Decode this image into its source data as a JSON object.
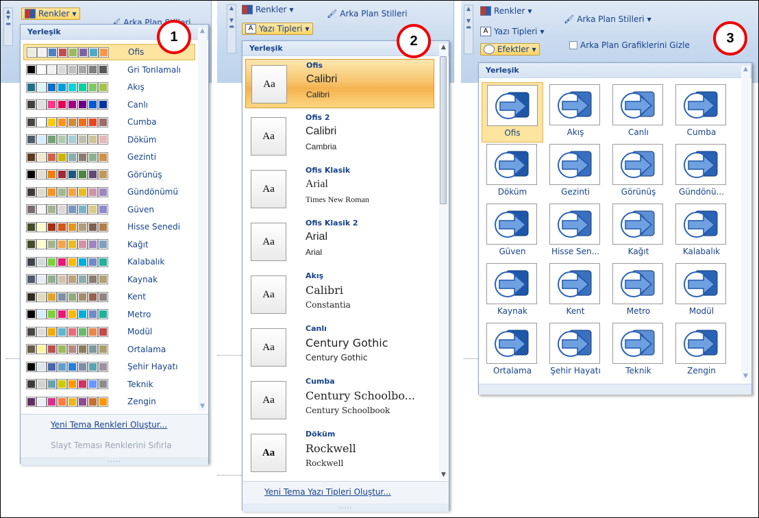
{
  "panel1": {
    "ribbon_button": "Renkler",
    "ribbon_neighbor": "Arka Plan Stilleri",
    "header": "Yerleşik",
    "badge": "1",
    "items": [
      {
        "label": "Ofis",
        "colors": [
          "#eeece1",
          "#f2f2f2",
          "#4f81bd",
          "#c0504d",
          "#9bbb59",
          "#8064a2",
          "#4bacc6",
          "#f79646"
        ]
      },
      {
        "label": "Gri Tonlamalı",
        "colors": [
          "#000000",
          "#ffffff",
          "#f2f2f2",
          "#d9d9d9",
          "#bfbfbf",
          "#a6a6a6",
          "#7f7f7f",
          "#595959"
        ]
      },
      {
        "label": "Akış",
        "colors": [
          "#1f6f8b",
          "#dbf5f9",
          "#0f6fc6",
          "#009dd9",
          "#0bd0d9",
          "#10cf9b",
          "#7cca62",
          "#a5c249"
        ]
      },
      {
        "label": "Canlı",
        "colors": [
          "#404040",
          "#dfdfdf",
          "#ff388c",
          "#e40059",
          "#9c007f",
          "#68007f",
          "#005bd3",
          "#00349e"
        ]
      },
      {
        "label": "Cumba",
        "colors": [
          "#444444",
          "#ffffff",
          "#ffca08",
          "#f8931d",
          "#ce8d3e",
          "#ec7016",
          "#e64823",
          "#9c6a6a"
        ]
      },
      {
        "label": "Döküm",
        "colors": [
          "#4e5b6f",
          "#d6ecff",
          "#72a376",
          "#b0ccb0",
          "#a8cdd7",
          "#c0beaf",
          "#cec597",
          "#e8b7b7"
        ]
      },
      {
        "label": "Gezinti",
        "colors": [
          "#5e3a1c",
          "#f4e7cc",
          "#d16349",
          "#ccb400",
          "#8cadae",
          "#8c7b70",
          "#8fb08c",
          "#d19049"
        ]
      },
      {
        "label": "Görünüş",
        "colors": [
          "#000000",
          "#e3ded1",
          "#f07f09",
          "#9f2936",
          "#1b587c",
          "#4e8542",
          "#604878",
          "#c19859"
        ]
      },
      {
        "label": "Gündönümü",
        "colors": [
          "#3a3a3a",
          "#dfdccb",
          "#f8931d",
          "#a5b592",
          "#f3a447",
          "#e7bc29",
          "#d092a7",
          "#9c85c0"
        ]
      },
      {
        "label": "Güven",
        "colors": [
          "#786c71",
          "#f8f5f6",
          "#a5b592",
          "#ded7d7",
          "#7a98bd",
          "#7ab4c8",
          "#dccb86",
          "#8f89d1"
        ]
      },
      {
        "label": "Hisse Senedi",
        "colors": [
          "#444d26",
          "#fefac9",
          "#a5300f",
          "#d55816",
          "#e19825",
          "#b19c7d",
          "#7f5f52",
          "#b27d49"
        ]
      },
      {
        "label": "Kağıt",
        "colors": [
          "#444d26",
          "#fefac9",
          "#a5b592",
          "#f3a447",
          "#e7bc29",
          "#d092a7",
          "#9c85c0",
          "#809ec2"
        ]
      },
      {
        "label": "Kalabalık",
        "colors": [
          "#3c434d",
          "#d4d9dd",
          "#7fd13b",
          "#ea157a",
          "#feb80a",
          "#00addc",
          "#738ac8",
          "#1ab39f"
        ]
      },
      {
        "label": "Kaynak",
        "colors": [
          "#4e5b6f",
          "#e6ecf5",
          "#8fb08c",
          "#d1c2b0",
          "#bea07a",
          "#8cadae",
          "#8c7b70",
          "#b0a179"
        ]
      },
      {
        "label": "Kent",
        "colors": [
          "#2f2b20",
          "#dfdcb7",
          "#e0a52c",
          "#7f8fa9",
          "#95a97f",
          "#a28e6a",
          "#956251",
          "#918485"
        ]
      },
      {
        "label": "Metro",
        "colors": [
          "#000000",
          "#d6ecff",
          "#7fd13b",
          "#ea157a",
          "#feb80a",
          "#00addc",
          "#738ac8",
          "#1ab39f"
        ]
      },
      {
        "label": "Modül",
        "colors": [
          "#464646",
          "#dedede",
          "#f0ad00",
          "#60b5cc",
          "#e66c7d",
          "#6bb76d",
          "#e88651",
          "#c64847"
        ]
      },
      {
        "label": "Ortalama",
        "colors": [
          "#695d46",
          "#fff39d",
          "#c0504d",
          "#9bbb59",
          "#b58b80",
          "#8b7e5e",
          "#7e9a9e",
          "#ac9f6e"
        ]
      },
      {
        "label": "Şehir Hayatı",
        "colors": [
          "#000000",
          "#dde4ed",
          "#4a66ac",
          "#629dd1",
          "#297fd5",
          "#7f8fa9",
          "#5aa2ae",
          "#9d90a0"
        ]
      },
      {
        "label": "Teknik",
        "colors": [
          "#3b3b3b",
          "#d4d2d0",
          "#6ea0b0",
          "#cccc00",
          "#ff9900",
          "#cc3366",
          "#6699ff",
          "#8c8c8c"
        ]
      },
      {
        "label": "Zengin",
        "colors": [
          "#632e62",
          "#eaf0f8",
          "#d5318d",
          "#fe7d3f",
          "#e8b91f",
          "#8d4b91",
          "#c67035",
          "#ff9900"
        ]
      }
    ],
    "footer_link1": "Yeni Tema Renkleri Oluştur...",
    "footer_link2": "Slayt Teması Renklerini Sıfırla",
    "grip": "....."
  },
  "panel2": {
    "ribbon_colors": "Renkler",
    "ribbon_button": "Yazı Tipleri",
    "ribbon_neighbor": "Arka Plan Stilleri",
    "header": "Yerleşik",
    "badge": "2",
    "sample": "Aa",
    "items": [
      {
        "name": "Ofis",
        "heading": "Calibri",
        "body": "Calibri"
      },
      {
        "name": "Ofis 2",
        "heading": "Calibri",
        "body": "Cambria"
      },
      {
        "name": "Ofis Klasik",
        "heading": "Arial",
        "body": "Times New Roman"
      },
      {
        "name": "Ofis Klasik 2",
        "heading": "Arial",
        "body": "Arial"
      },
      {
        "name": "Akış",
        "heading": "Calibri",
        "body": "Constantia"
      },
      {
        "name": "Canlı",
        "heading": "Century Gothic",
        "body": "Century Gothic"
      },
      {
        "name": "Cumba",
        "heading": "Century Schoolbo...",
        "body": "Century Schoolbook"
      },
      {
        "name": "Döküm",
        "heading": "Rockwell",
        "body": "Rockwell"
      }
    ],
    "footer_link": "Yeni Tema Yazı Tipleri Oluştur...",
    "grip": "....."
  },
  "panel3": {
    "ribbon_colors": "Renkler",
    "ribbon_fonts": "Yazı Tipleri",
    "ribbon_button": "Efektler",
    "ribbon_bg_styles": "Arka Plan Stilleri",
    "ribbon_hide": "Arka Plan Grafiklerini Gizle",
    "header": "Yerleşik",
    "badge": "3",
    "items": [
      "Ofis",
      "Akış",
      "Canlı",
      "Cumba",
      "Döküm",
      "Gezinti",
      "Görünüş",
      "Gündönü...",
      "Güven",
      "Hisse Sen...",
      "Kağıt",
      "Kalabalık",
      "Kaynak",
      "Kent",
      "Metro",
      "Modül",
      "Ortalama",
      "Şehir Hayatı",
      "Teknik",
      "Zengin"
    ]
  }
}
